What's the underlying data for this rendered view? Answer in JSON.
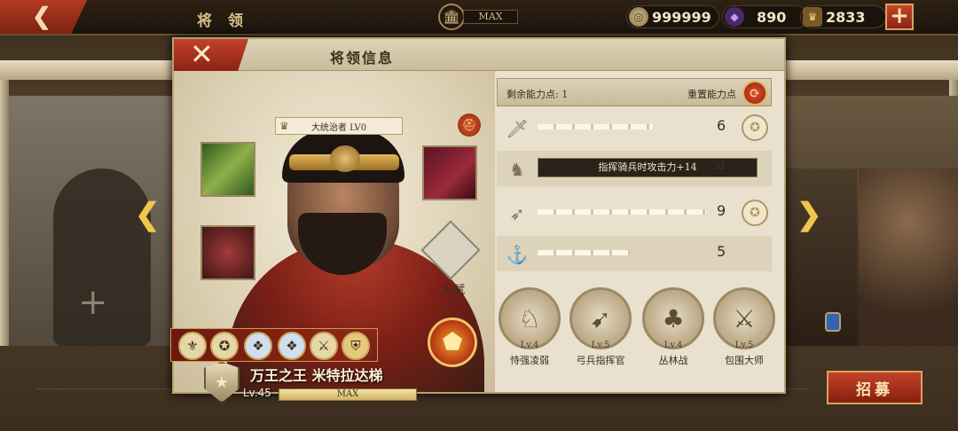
{
  "topbar": {
    "back_icon": "back-arrow-icon",
    "title": "将 领",
    "building_max": "MAX",
    "silver": "999999",
    "gems": "890",
    "rank_points": "2833",
    "plus": "+"
  },
  "dialog": {
    "title": "将领信息",
    "close": "✕",
    "lord_tag": "大统治者 LV0",
    "talent_label": "天赋",
    "hero_name": "万王之王 米特拉达梯",
    "hero_level": "Lv.45",
    "exp_text": "MAX"
  },
  "stats": {
    "points_label": "剩余能力点: 1",
    "reset_label": "重置能力点",
    "rows": [
      {
        "icon": "sword-icon",
        "value": "6"
      },
      {
        "icon": "horse-icon",
        "value": "4",
        "tooltip": "指挥骑兵时攻击力+14"
      },
      {
        "icon": "bow-icon",
        "value": "9"
      },
      {
        "icon": "anchor-icon",
        "value": "5"
      }
    ]
  },
  "arts": [
    {
      "level": "Lv.4",
      "name": "恃强凌弱"
    },
    {
      "level": "Lv.5",
      "name": "弓兵指挥官"
    },
    {
      "level": "Lv.4",
      "name": "丛林战"
    },
    {
      "level": "Lv.5",
      "name": "包围大师"
    }
  ],
  "side": {
    "recruit": "招募"
  }
}
